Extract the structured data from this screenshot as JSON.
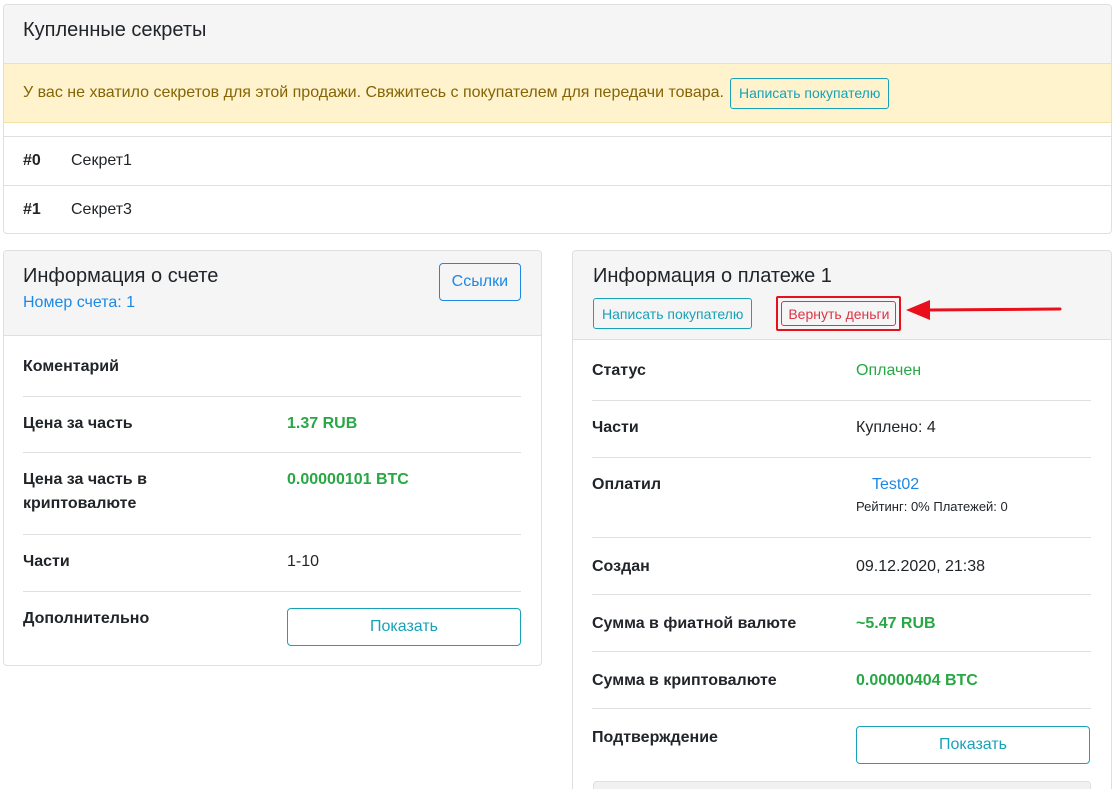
{
  "secrets_card": {
    "title": "Купленные секреты",
    "alert_text": "У вас не хватило секретов для этой продажи. Свяжитесь с покупателем для передачи товара.",
    "alert_button": "Написать покупателю",
    "secrets": [
      {
        "num": "#0",
        "name": "Секрет1"
      },
      {
        "num": "#1",
        "name": "Секрет3"
      }
    ]
  },
  "account_card": {
    "title": "Информация о счете",
    "subtitle": "Номер счета: 1",
    "links_button": "Ссылки",
    "rows": {
      "comment_label": "Коментарий",
      "price_label": "Цена за часть",
      "price_value": "1.37 RUB",
      "crypto_price_label": "Цена за часть в криптовалюте",
      "crypto_price_value": "0.00000101 BTC",
      "parts_label": "Части",
      "parts_value": "1-10",
      "extra_label": "Дополнительно",
      "extra_button": "Показать"
    }
  },
  "payment_card": {
    "title": "Информация о платеже 1",
    "contact_button": "Написать покупателю",
    "refund_button": "Вернуть деньги",
    "rows": {
      "status_label": "Статус",
      "status_value": "Оплачен",
      "parts_label": "Части",
      "parts_value": "Куплено: 4",
      "payer_label": "Оплатил",
      "payer_name": "Test02",
      "payer_meta": "Рейтинг: 0% Платежей: 0",
      "created_label": "Создан",
      "created_value": "09.12.2020, 21:38",
      "fiat_label": "Сумма в фиатной валюте",
      "fiat_value": "~5.47 RUB",
      "crypto_label": "Сумма в криптовалюте",
      "crypto_value": "0.00000404 BTC",
      "confirm_label": "Подтверждение",
      "confirm_button": "Показать"
    }
  },
  "colors": {
    "accent_blue": "#1e88e5",
    "teal": "#17a2b8",
    "green": "#28a745",
    "danger": "#dc3545",
    "annotation_red": "#e8101b",
    "warning_bg": "#fff3cd"
  }
}
